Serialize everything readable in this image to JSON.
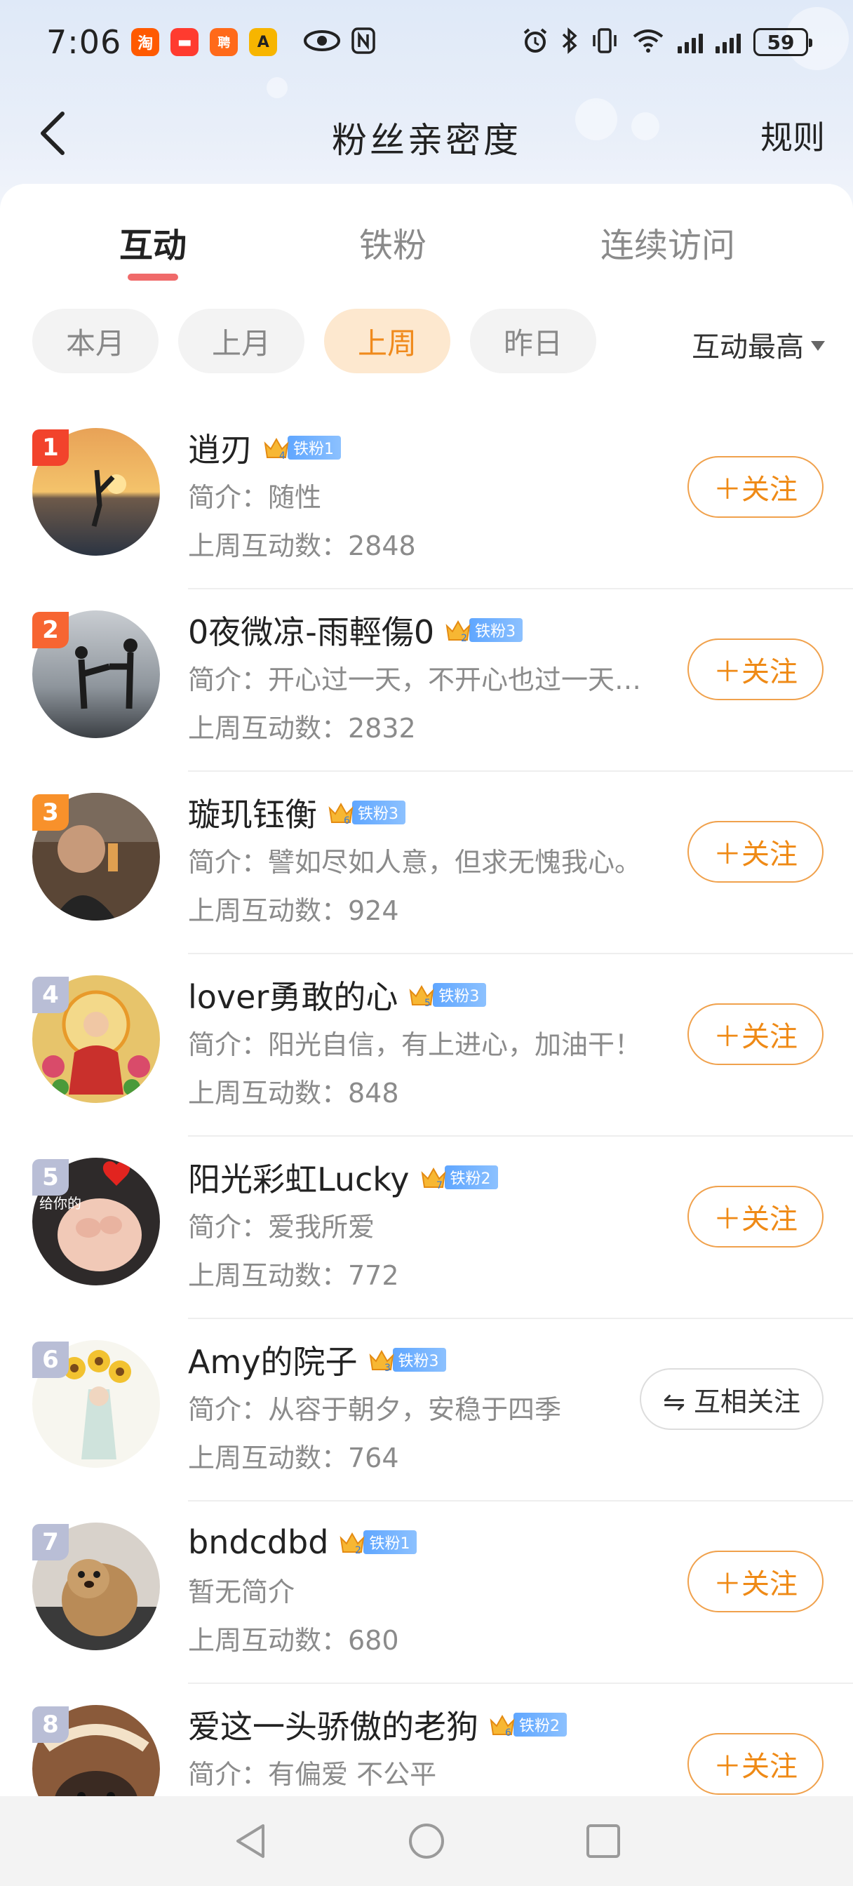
{
  "status_bar": {
    "time": "7:06",
    "battery": "59",
    "apps": [
      {
        "name": "taobao-icon",
        "glyph": "淘",
        "color": "#ff5a00"
      },
      {
        "name": "app-icon-2",
        "glyph": "▬",
        "color": "#ff3b2f"
      },
      {
        "name": "app-icon-3",
        "glyph": "聘",
        "color": "#ff6a1a"
      },
      {
        "name": "app-icon-4",
        "glyph": "A",
        "color": "#f7b500"
      }
    ]
  },
  "header": {
    "title": "粉丝亲密度",
    "rules": "规则"
  },
  "tabs": [
    {
      "label": "互动",
      "active": true
    },
    {
      "label": "铁粉",
      "active": false
    },
    {
      "label": "连续访问",
      "active": false
    }
  ],
  "filters": [
    {
      "label": "本月",
      "active": false
    },
    {
      "label": "上月",
      "active": false
    },
    {
      "label": "上周",
      "active": true
    },
    {
      "label": "昨日",
      "active": false
    }
  ],
  "sort": {
    "label": "互动最高"
  },
  "fans": [
    {
      "rank": "1",
      "name": "逍刃",
      "crown_level": "4",
      "badge": "铁粉1",
      "bio": "简介：随性",
      "count": "上周互动数：2848",
      "action": "＋关注"
    },
    {
      "rank": "2",
      "name": "0夜微凉-雨輕傷0",
      "crown_level": "2",
      "badge": "铁粉3",
      "bio": "简介：开心过一天，不开心也过一天…",
      "count": "上周互动数：2832",
      "action": "＋关注"
    },
    {
      "rank": "3",
      "name": "璇玑钰衡",
      "crown_level": "6",
      "badge": "铁粉3",
      "bio": "简介：譬如尽如人意，但求无愧我心。",
      "count": "上周互动数：924",
      "action": "＋关注"
    },
    {
      "rank": "4",
      "name": "lover勇敢的心",
      "crown_level": "5",
      "badge": "铁粉3",
      "bio": "简介：阳光自信，有上进心，加油干！",
      "count": "上周互动数：848",
      "action": "＋关注"
    },
    {
      "rank": "5",
      "name": "阳光彩虹Lucky",
      "crown_level": "7",
      "badge": "铁粉2",
      "bio": "简介：爱我所爱",
      "count": "上周互动数：772",
      "action": "＋关注"
    },
    {
      "rank": "6",
      "name": "Amy的院子",
      "crown_level": "3",
      "badge": "铁粉3",
      "bio": "简介：从容于朝夕，安稳于四季",
      "count": "上周互动数：764",
      "action": "⇋ 互相关注"
    },
    {
      "rank": "7",
      "name": "bndcdbd",
      "crown_level": "2",
      "badge": "铁粉1",
      "bio": "暂无简介",
      "count": "上周互动数：680",
      "action": "＋关注"
    },
    {
      "rank": "8",
      "name": "爱这一头骄傲的老狗",
      "crown_level": "6",
      "badge": "铁粉2",
      "bio": "简介：有偏爱 不公平",
      "count": "",
      "action": "＋关注"
    }
  ],
  "avatar_overlay_text": "给你的",
  "colors": {
    "accent": "#ef8a16",
    "chip_active_bg": "#fde8cf",
    "tab_underline": "#f06a6a",
    "badge": "#5fa6ff"
  }
}
